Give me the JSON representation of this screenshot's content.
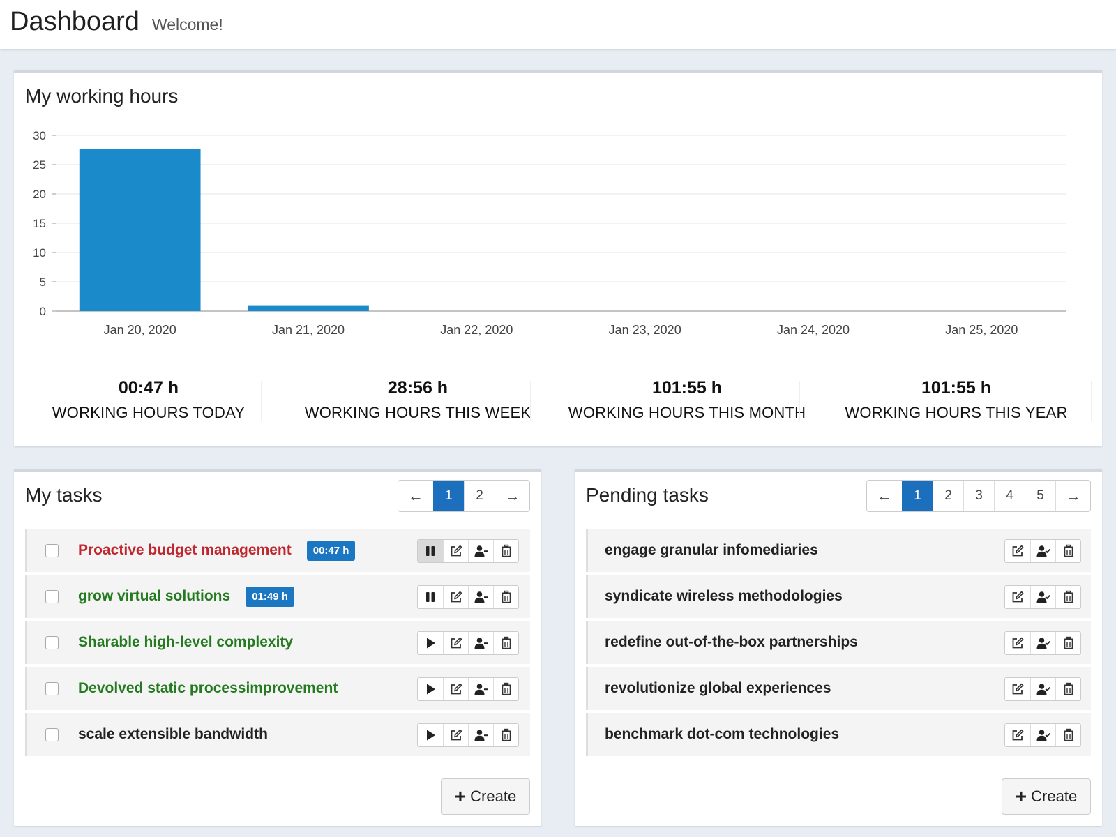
{
  "header": {
    "title": "Dashboard",
    "subtitle": "Welcome!"
  },
  "working_hours": {
    "title": "My working hours",
    "stats": [
      {
        "value": "00:47 h",
        "label": "WORKING HOURS TODAY"
      },
      {
        "value": "28:56 h",
        "label": "WORKING HOURS THIS WEEK"
      },
      {
        "value": "101:55 h",
        "label": "WORKING HOURS THIS MONTH"
      },
      {
        "value": "101:55 h",
        "label": "WORKING HOURS THIS YEAR"
      }
    ]
  },
  "chart_data": {
    "type": "bar",
    "categories": [
      "Jan 20, 2020",
      "Jan 21, 2020",
      "Jan 22, 2020",
      "Jan 23, 2020",
      "Jan 24, 2020",
      "Jan 25, 2020"
    ],
    "values": [
      27.7,
      1.0,
      0,
      0,
      0,
      0
    ],
    "title": "",
    "xlabel": "",
    "ylabel": "",
    "ylim": [
      0,
      30
    ],
    "yticks": [
      0,
      5,
      10,
      15,
      20,
      25,
      30
    ],
    "grid": true,
    "bar_color": "#1b8acb"
  },
  "my_tasks": {
    "title": "My tasks",
    "pager": {
      "prev": "←",
      "pages": [
        "1",
        "2"
      ],
      "active": "1",
      "next": "→"
    },
    "tasks": [
      {
        "name": "Proactive budget management",
        "color": "#c0262d",
        "time": "00:47 h",
        "running": true
      },
      {
        "name": "grow virtual solutions",
        "color": "#247a1f",
        "time": "01:49 h",
        "running": true
      },
      {
        "name": "Sharable high-level complexity",
        "color": "#247a1f",
        "time": "",
        "running": false
      },
      {
        "name": "Devolved static processimprovement",
        "color": "#247a1f",
        "time": "",
        "running": false
      },
      {
        "name": "scale extensible bandwidth",
        "color": "#222222",
        "time": "",
        "running": false
      }
    ],
    "create_label": "Create"
  },
  "pending_tasks": {
    "title": "Pending tasks",
    "pager": {
      "prev": "←",
      "pages": [
        "1",
        "2",
        "3",
        "4",
        "5"
      ],
      "active": "1",
      "next": "→"
    },
    "tasks": [
      {
        "name": "engage granular infomediaries"
      },
      {
        "name": "syndicate wireless methodologies"
      },
      {
        "name": "redefine out-of-the-box partnerships"
      },
      {
        "name": "revolutionize global experiences"
      },
      {
        "name": "benchmark dot-com technologies"
      }
    ],
    "create_label": "Create"
  },
  "colors": {
    "accent": "#1c6fbd",
    "badge": "#1c77c3",
    "bar": "#1b8acb"
  },
  "icons": {
    "pause": "pause-icon",
    "play": "play-icon",
    "edit": "edit-icon",
    "assign": "assign-user-icon",
    "unassign": "unassign-user-icon",
    "delete": "trash-icon",
    "plus": "plus-icon"
  }
}
